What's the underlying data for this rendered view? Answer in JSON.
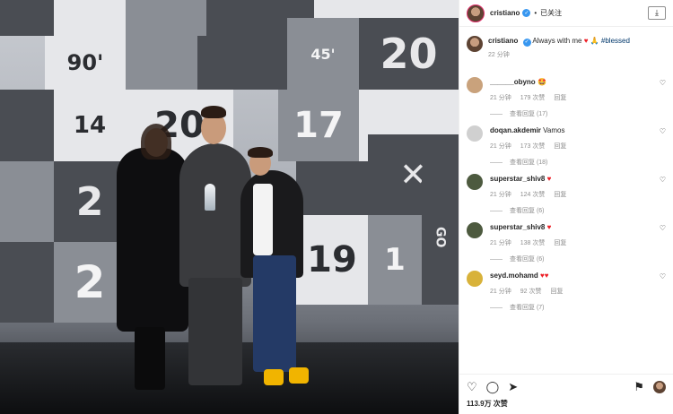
{
  "header": {
    "username": "cristiano",
    "follow_label": "已关注",
    "dot": "•"
  },
  "caption": {
    "username": "cristiano",
    "text": "Always with me",
    "hashtag": "#blessed",
    "time": "22 分钟"
  },
  "comments": [
    {
      "username": "______obyno",
      "text": "",
      "emoji": "🤩",
      "time": "21 分钟",
      "likes": "179 次赞",
      "reply": "回复",
      "view_replies": "查看回复 (17)",
      "avatar_color": "#c9a27c"
    },
    {
      "username": "doqan.akdemir",
      "text": "Vamos",
      "emoji": "",
      "time": "21 分钟",
      "likes": "173 次赞",
      "reply": "回复",
      "view_replies": "查看回复 (18)",
      "avatar_color": "#d0d0d0"
    },
    {
      "username": "superstar_shiv8",
      "text": "",
      "emoji": "♥",
      "time": "21 分钟",
      "likes": "124 次赞",
      "reply": "回复",
      "view_replies": "查看回复 (6)",
      "avatar_color": "#4d5a3f"
    },
    {
      "username": "superstar_shiv8",
      "text": "",
      "emoji": "♥",
      "time": "21 分钟",
      "likes": "138 次赞",
      "reply": "回复",
      "view_replies": "查看回复 (6)",
      "avatar_color": "#4d5a3f"
    },
    {
      "username": "seyd.mohamd",
      "text": "",
      "emoji": "♥♥",
      "time": "21 分钟",
      "likes": "92 次赞",
      "reply": "回复",
      "view_replies": "查看回复 (7)",
      "avatar_color": "#d8b23a"
    }
  ],
  "footer": {
    "likes_count": "113.9万 次赞"
  },
  "icons": {
    "heart": "♡",
    "comment": "◯",
    "share": "➤",
    "bookmark": "⚑",
    "download": "⤓",
    "verified": "✓"
  },
  "photo": {
    "numbers": [
      "90'",
      "20",
      "14",
      "45'",
      "14",
      "17",
      "20",
      "2",
      "19",
      "1",
      "GO",
      "45'",
      "14",
      "17",
      "2"
    ]
  },
  "colors": {
    "accent": "#3897f0",
    "heart_red": "#ed1c24",
    "hashtag": "#00376b",
    "muted": "#8e8e8e"
  }
}
